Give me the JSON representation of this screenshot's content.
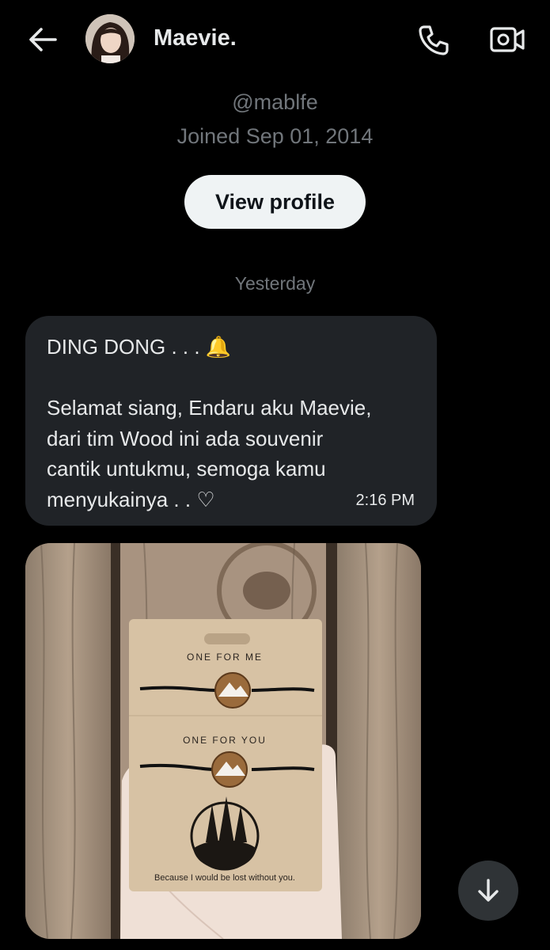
{
  "header": {
    "name": "Maevie.",
    "back_icon": "arrow-left-icon",
    "call_icon": "phone-icon",
    "video_icon": "video-camera-icon"
  },
  "profile": {
    "handle": "@mablfe",
    "joined": "Joined Sep 01, 2014",
    "view_profile_label": "View profile"
  },
  "chat": {
    "date_divider": "Yesterday",
    "message": {
      "text": "DING DONG . . . 🔔\n\nSelamat siang, Endaru aku Maevie,\ndari tim Wood ini ada souvenir\ncantik untukmu, semoga kamu\nmenyukainya . . ♡",
      "time": "2:16 PM"
    },
    "image": {
      "card_top_text": "ONE FOR ME",
      "card_mid_text": "ONE FOR YOU",
      "card_bottom_text": "Because I would be lost without you."
    }
  },
  "scroll_down_icon": "arrow-down-icon",
  "colors": {
    "background": "#000000",
    "bubble": "#202327",
    "secondary_text": "#71767b",
    "button_bg": "#eff3f4"
  }
}
